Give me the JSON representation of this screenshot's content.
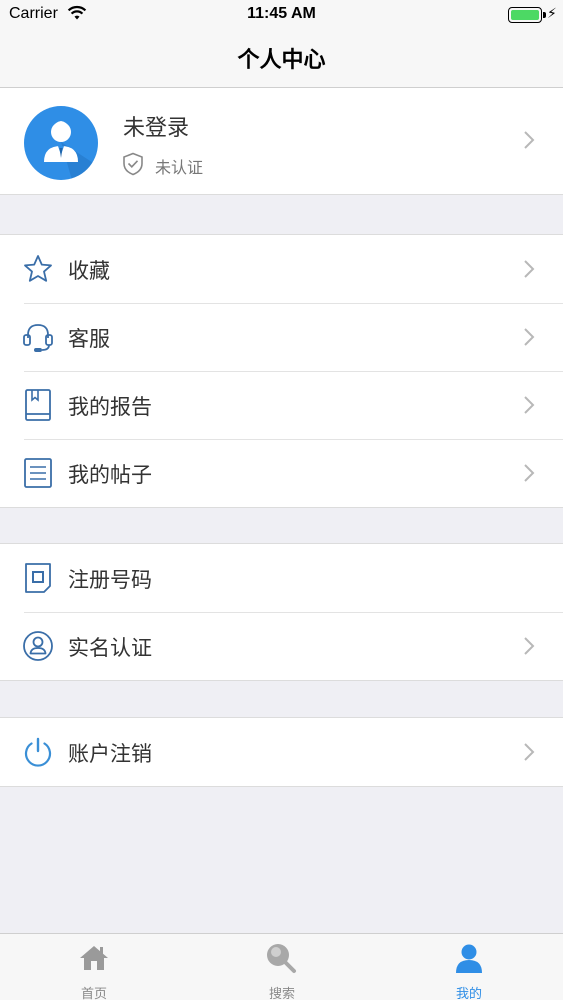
{
  "status_bar": {
    "carrier": "Carrier",
    "time": "11:45 AM",
    "battery": "full"
  },
  "nav": {
    "title": "个人中心"
  },
  "profile": {
    "name": "未登录",
    "verify_status": "未认证"
  },
  "group1": [
    {
      "label": "收藏",
      "icon": "star-icon"
    },
    {
      "label": "客服",
      "icon": "headset-icon"
    },
    {
      "label": "我的报告",
      "icon": "book-icon"
    },
    {
      "label": "我的帖子",
      "icon": "document-icon"
    }
  ],
  "group2": [
    {
      "label": "注册号码",
      "icon": "sim-card-icon"
    },
    {
      "label": "实名认证",
      "icon": "user-circle-icon"
    }
  ],
  "group3": [
    {
      "label": "账户注销",
      "icon": "power-icon"
    }
  ],
  "tab_bar": {
    "tabs": [
      {
        "label": "首页",
        "icon": "home-icon"
      },
      {
        "label": "搜索",
        "icon": "search-icon"
      },
      {
        "label": "我的",
        "icon": "person-icon"
      }
    ],
    "active_index": 2
  },
  "colors": {
    "accent": "#2f8ee6",
    "icon_blue": "#3a6ea8",
    "background": "#efeff4"
  }
}
